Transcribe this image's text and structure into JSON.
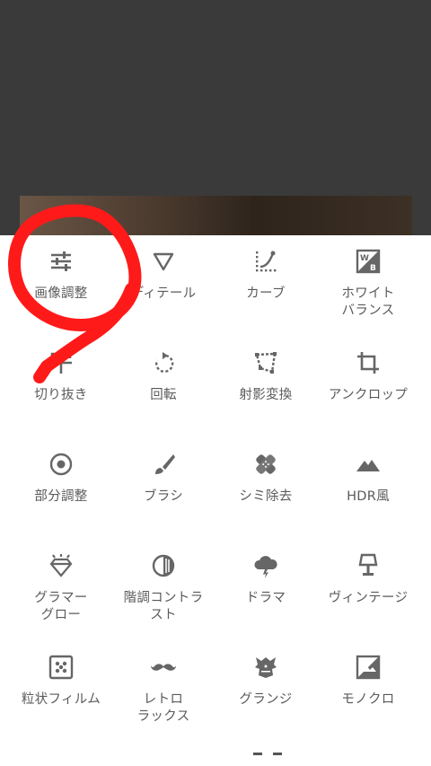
{
  "tools": [
    {
      "label": "画像調整",
      "icon": "tune-sliders-icon"
    },
    {
      "label": "ディテール",
      "icon": "triangle-details-icon"
    },
    {
      "label": "カーブ",
      "icon": "curves-icon"
    },
    {
      "label": "ホワイト\nバランス",
      "icon": "white-balance-icon"
    },
    {
      "label": "切り抜き",
      "icon": "crop-expand-icon"
    },
    {
      "label": "回転",
      "icon": "rotate-icon"
    },
    {
      "label": "射影変換",
      "icon": "perspective-icon"
    },
    {
      "label": "アンクロップ",
      "icon": "uncrop-icon"
    },
    {
      "label": "部分調整",
      "icon": "selective-target-icon"
    },
    {
      "label": "ブラシ",
      "icon": "brush-icon"
    },
    {
      "label": "シミ除去",
      "icon": "healing-bandage-icon"
    },
    {
      "label": "HDR風",
      "icon": "mountain-hdr-icon"
    },
    {
      "label": "グラマー\nグロー",
      "icon": "diamond-glow-icon"
    },
    {
      "label": "階調コントラ\nスト",
      "icon": "tonal-contrast-icon"
    },
    {
      "label": "ドラマ",
      "icon": "storm-cloud-icon"
    },
    {
      "label": "ヴィンテージ",
      "icon": "lamp-icon"
    },
    {
      "label": "粒状フィルム",
      "icon": "grain-film-icon"
    },
    {
      "label": "レトロ\nラックス",
      "icon": "mustache-icon"
    },
    {
      "label": "グランジ",
      "icon": "guitar-icon"
    },
    {
      "label": "モノクロ",
      "icon": "black-white-icon"
    }
  ],
  "annotation": {
    "color": "#ff1a1a",
    "mark": "handwritten-9"
  }
}
